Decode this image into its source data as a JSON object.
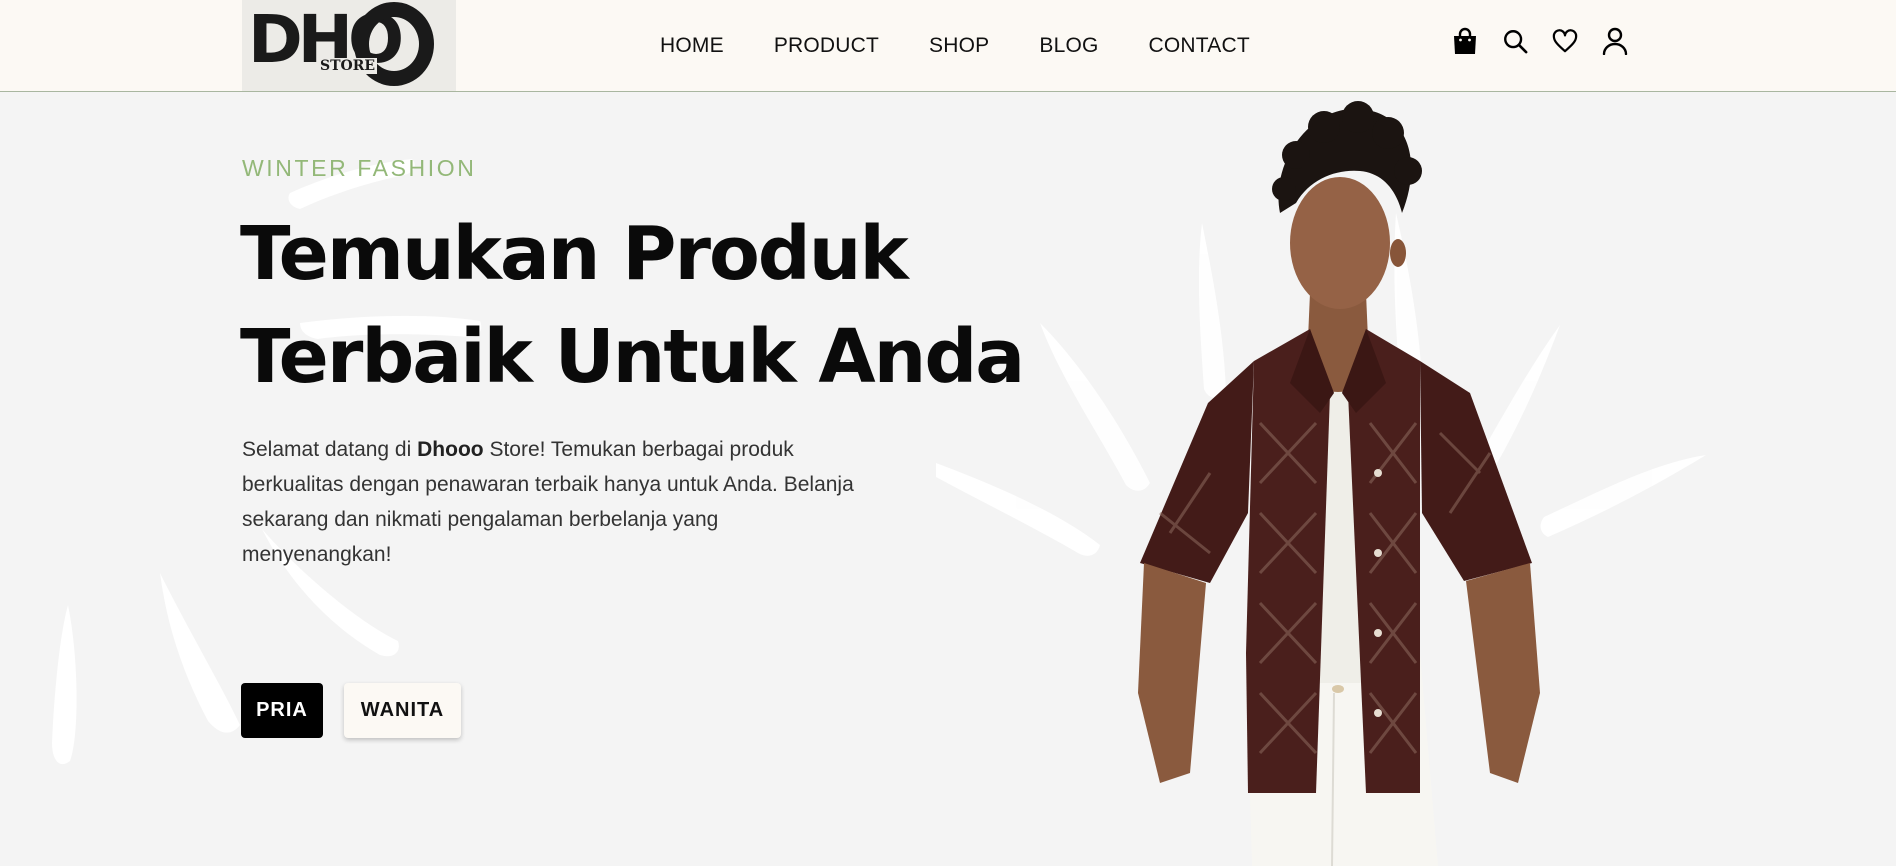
{
  "brand": {
    "logo_letters": "DHO",
    "logo_sub": "STORE"
  },
  "nav": {
    "items": [
      "HOME",
      "PRODUCT",
      "SHOP",
      "BLOG",
      "CONTACT"
    ]
  },
  "header_icons": [
    "shopping-bag-icon",
    "search-icon",
    "heart-icon",
    "user-icon"
  ],
  "hero": {
    "eyebrow": "WINTER FASHION",
    "headline_line1": "Temukan Produk",
    "headline_line2": "Terbaik Untuk Anda",
    "description_pre": "Selamat datang di ",
    "description_brand": "Dhooo",
    "description_post": " Store! Temukan berbagai produk berkualitas dengan penawaran terbaik hanya untuk Anda. Belanja sekarang dan nikmati pengalaman berbelanja yang menyenangkan!",
    "buttons": {
      "men": "PRIA",
      "women": "WANITA"
    }
  },
  "colors": {
    "header_bg": "#fcf9f4",
    "hero_bg": "#f4f4f4",
    "eyebrow": "#93b878",
    "primary_button": "#000000",
    "secondary_button": "#fcf9f4",
    "shirt": "#4a1f1c"
  }
}
